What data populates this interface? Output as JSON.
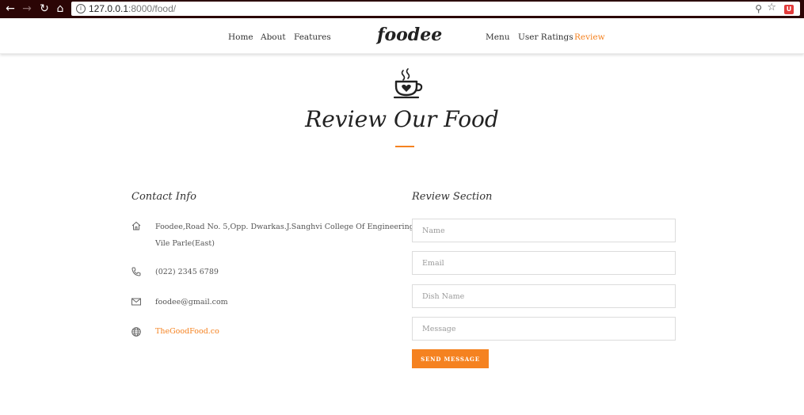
{
  "browser": {
    "url_host": "127.0.0.1",
    "url_path": ":8000/food/",
    "icons": [
      "back-icon",
      "forward-icon",
      "reload-icon",
      "home-icon",
      "info-icon",
      "zoom-icon",
      "star-icon",
      "extension-icon"
    ]
  },
  "nav": {
    "left": [
      "Home",
      "About",
      "Features"
    ],
    "brand": "foodee",
    "right": [
      "Menu",
      "User Ratings",
      "Review"
    ],
    "active": "Review"
  },
  "hero": {
    "icon": "coffee-cup-heart-icon",
    "title": "Review Our Food"
  },
  "contact": {
    "heading": "Contact Info",
    "address_line1": "Foodee,Road No. 5,Opp. Dwarkas.J.Sanghvi College Of Engineering,",
    "address_line2": "Vile Parle(East)",
    "phone": "(022) 2345 6789",
    "email": "foodee@gmail.com",
    "website": "TheGoodFood.co"
  },
  "review": {
    "heading": "Review Section",
    "name_placeholder": "Name",
    "email_placeholder": "Email",
    "dish_placeholder": "Dish Name",
    "message_placeholder": "Message",
    "submit_label": "SEND MESSAGE"
  },
  "colors": {
    "accent": "#f58220",
    "chrome": "#2b0505",
    "text": "#333333"
  }
}
